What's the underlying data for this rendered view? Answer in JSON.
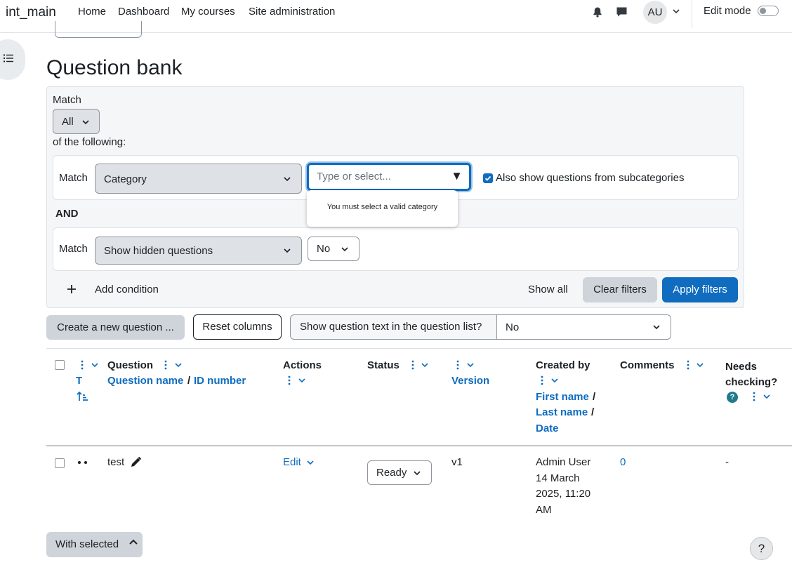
{
  "navbar": {
    "brand": "int_main",
    "links": [
      "Home",
      "Dashboard",
      "My courses",
      "Site administration"
    ],
    "avatar_initials": "AU",
    "edit_mode_label": "Edit mode"
  },
  "page_title": "Question bank",
  "filters": {
    "match_label": "Match",
    "match_value": "All",
    "of_following": "of the following:",
    "condition1": {
      "match_label": "Match",
      "type": "Category",
      "input_placeholder": "Type or select...",
      "subcategories_label": "Also show questions from subcategories",
      "validation_message": "You must select a valid category"
    },
    "and_label": "AND",
    "condition2": {
      "match_label": "Match",
      "type": "Show hidden questions",
      "value": "No"
    },
    "add_condition": "Add condition",
    "show_all": "Show all",
    "clear_filters": "Clear filters",
    "apply_filters": "Apply filters"
  },
  "toolbar": {
    "create_new_question": "Create a new question ...",
    "reset_columns": "Reset columns",
    "show_question_text_label": "Show question text in the question list?",
    "show_question_text_value": "No"
  },
  "table": {
    "headers": {
      "type_short": "T",
      "question": "Question",
      "question_name": "Question name",
      "slash": "/",
      "id_number": "ID number",
      "actions": "Actions",
      "status": "Status",
      "version": "Version",
      "created_by": "Created by",
      "first_name": "First name",
      "last_name": "Last name",
      "date": "Date",
      "comments": "Comments",
      "needs_checking": "Needs checking?"
    },
    "rows": [
      {
        "name": "test",
        "action": "Edit",
        "status": "Ready",
        "version": "v1",
        "created_by_line1": "Admin User",
        "created_by_line2": "14 March",
        "created_by_line3": "2025, 11:20",
        "created_by_line4": "AM",
        "comments": "0",
        "needs_checking": "-"
      }
    ]
  },
  "with_selected": "With selected",
  "help_button": "?",
  "colors": {
    "primary": "#0f6cbf",
    "secondary": "#ced4da",
    "help_badge": "#1f7a8c"
  }
}
